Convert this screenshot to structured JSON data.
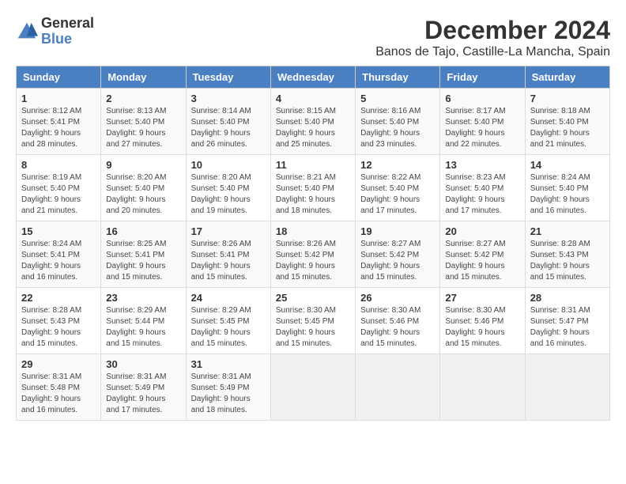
{
  "logo": {
    "general": "General",
    "blue": "Blue"
  },
  "header": {
    "title": "December 2024",
    "subtitle": "Banos de Tajo, Castille-La Mancha, Spain"
  },
  "weekdays": [
    "Sunday",
    "Monday",
    "Tuesday",
    "Wednesday",
    "Thursday",
    "Friday",
    "Saturday"
  ],
  "weeks": [
    [
      {
        "day": "1",
        "sunrise": "8:12 AM",
        "sunset": "5:41 PM",
        "daylight": "9 hours and 28 minutes."
      },
      {
        "day": "2",
        "sunrise": "8:13 AM",
        "sunset": "5:40 PM",
        "daylight": "9 hours and 27 minutes."
      },
      {
        "day": "3",
        "sunrise": "8:14 AM",
        "sunset": "5:40 PM",
        "daylight": "9 hours and 26 minutes."
      },
      {
        "day": "4",
        "sunrise": "8:15 AM",
        "sunset": "5:40 PM",
        "daylight": "9 hours and 25 minutes."
      },
      {
        "day": "5",
        "sunrise": "8:16 AM",
        "sunset": "5:40 PM",
        "daylight": "9 hours and 23 minutes."
      },
      {
        "day": "6",
        "sunrise": "8:17 AM",
        "sunset": "5:40 PM",
        "daylight": "9 hours and 22 minutes."
      },
      {
        "day": "7",
        "sunrise": "8:18 AM",
        "sunset": "5:40 PM",
        "daylight": "9 hours and 21 minutes."
      }
    ],
    [
      {
        "day": "8",
        "sunrise": "8:19 AM",
        "sunset": "5:40 PM",
        "daylight": "9 hours and 21 minutes."
      },
      {
        "day": "9",
        "sunrise": "8:20 AM",
        "sunset": "5:40 PM",
        "daylight": "9 hours and 20 minutes."
      },
      {
        "day": "10",
        "sunrise": "8:20 AM",
        "sunset": "5:40 PM",
        "daylight": "9 hours and 19 minutes."
      },
      {
        "day": "11",
        "sunrise": "8:21 AM",
        "sunset": "5:40 PM",
        "daylight": "9 hours and 18 minutes."
      },
      {
        "day": "12",
        "sunrise": "8:22 AM",
        "sunset": "5:40 PM",
        "daylight": "9 hours and 17 minutes."
      },
      {
        "day": "13",
        "sunrise": "8:23 AM",
        "sunset": "5:40 PM",
        "daylight": "9 hours and 17 minutes."
      },
      {
        "day": "14",
        "sunrise": "8:24 AM",
        "sunset": "5:40 PM",
        "daylight": "9 hours and 16 minutes."
      }
    ],
    [
      {
        "day": "15",
        "sunrise": "8:24 AM",
        "sunset": "5:41 PM",
        "daylight": "9 hours and 16 minutes."
      },
      {
        "day": "16",
        "sunrise": "8:25 AM",
        "sunset": "5:41 PM",
        "daylight": "9 hours and 15 minutes."
      },
      {
        "day": "17",
        "sunrise": "8:26 AM",
        "sunset": "5:41 PM",
        "daylight": "9 hours and 15 minutes."
      },
      {
        "day": "18",
        "sunrise": "8:26 AM",
        "sunset": "5:42 PM",
        "daylight": "9 hours and 15 minutes."
      },
      {
        "day": "19",
        "sunrise": "8:27 AM",
        "sunset": "5:42 PM",
        "daylight": "9 hours and 15 minutes."
      },
      {
        "day": "20",
        "sunrise": "8:27 AM",
        "sunset": "5:42 PM",
        "daylight": "9 hours and 15 minutes."
      },
      {
        "day": "21",
        "sunrise": "8:28 AM",
        "sunset": "5:43 PM",
        "daylight": "9 hours and 15 minutes."
      }
    ],
    [
      {
        "day": "22",
        "sunrise": "8:28 AM",
        "sunset": "5:43 PM",
        "daylight": "9 hours and 15 minutes."
      },
      {
        "day": "23",
        "sunrise": "8:29 AM",
        "sunset": "5:44 PM",
        "daylight": "9 hours and 15 minutes."
      },
      {
        "day": "24",
        "sunrise": "8:29 AM",
        "sunset": "5:45 PM",
        "daylight": "9 hours and 15 minutes."
      },
      {
        "day": "25",
        "sunrise": "8:30 AM",
        "sunset": "5:45 PM",
        "daylight": "9 hours and 15 minutes."
      },
      {
        "day": "26",
        "sunrise": "8:30 AM",
        "sunset": "5:46 PM",
        "daylight": "9 hours and 15 minutes."
      },
      {
        "day": "27",
        "sunrise": "8:30 AM",
        "sunset": "5:46 PM",
        "daylight": "9 hours and 15 minutes."
      },
      {
        "day": "28",
        "sunrise": "8:31 AM",
        "sunset": "5:47 PM",
        "daylight": "9 hours and 16 minutes."
      }
    ],
    [
      {
        "day": "29",
        "sunrise": "8:31 AM",
        "sunset": "5:48 PM",
        "daylight": "9 hours and 16 minutes."
      },
      {
        "day": "30",
        "sunrise": "8:31 AM",
        "sunset": "5:49 PM",
        "daylight": "9 hours and 17 minutes."
      },
      {
        "day": "31",
        "sunrise": "8:31 AM",
        "sunset": "5:49 PM",
        "daylight": "9 hours and 18 minutes."
      },
      null,
      null,
      null,
      null
    ]
  ]
}
